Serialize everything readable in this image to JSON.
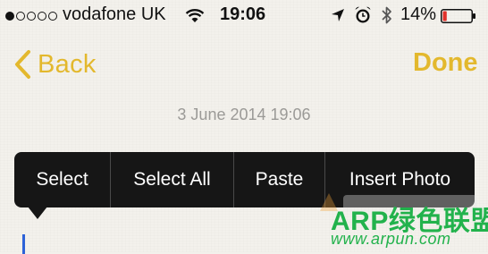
{
  "status_bar": {
    "signal_dots": [
      true,
      false,
      false,
      false,
      false
    ],
    "carrier": "vodafone UK",
    "time": "19:06",
    "battery_percent_label": "14%",
    "battery_level": 0.14,
    "icons": [
      "wifi-icon",
      "location-arrow-icon",
      "alarm-clock-icon",
      "bluetooth-icon",
      "battery-icon"
    ]
  },
  "nav": {
    "back_label": "Back",
    "done_label": "Done"
  },
  "note": {
    "date": "3 June 2014 19:06"
  },
  "edit_menu": {
    "items": [
      "Select",
      "Select All",
      "Paste",
      "Insert Photo"
    ]
  },
  "watermark": {
    "title": "ARP绿色联盟",
    "url": "www.arpun.com"
  },
  "colors": {
    "accent": "#e3b82d",
    "menu_bg": "#161616",
    "caret": "#2d62d8",
    "watermark": "#22b24c",
    "battery_low": "#e0302a"
  }
}
